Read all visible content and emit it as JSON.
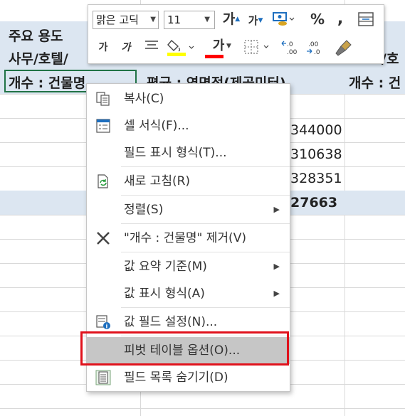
{
  "sheet": {
    "row1_label": "주요 용도",
    "row2_label": "사무/호텔/",
    "row2_right": "/호",
    "header": {
      "col1": "개수 : 건물명",
      "col2": "평균 : 연면적(제곱미터)",
      "col3": "개수 : 건"
    },
    "values": [
      "344000",
      "310638",
      "328351"
    ],
    "total": "27663"
  },
  "mini_toolbar": {
    "font_name": "맑은 고딕",
    "font_size": "11",
    "grow_font": "가",
    "shrink_font": "가",
    "percent": "%",
    "comma": ",",
    "bold": "가",
    "italic": "가",
    "font_color_letter": "가",
    "increase_decimal": "←.0\n.00",
    "decrease_decimal": ".00\n→.0"
  },
  "context_menu": {
    "items": [
      {
        "label": "복사(C)",
        "icon": "copy-icon"
      },
      {
        "label": "셀 서식(F)...",
        "icon": "format-cells-icon"
      },
      {
        "label": "필드 표시 형식(T)...",
        "icon": ""
      },
      {
        "label": "새로 고침(R)",
        "icon": "refresh-icon"
      },
      {
        "label": "정렬(S)",
        "icon": "",
        "submenu": true
      },
      {
        "label": "\"개수 : 건물명\" 제거(V)",
        "icon": "remove-icon"
      },
      {
        "label": "값 요약 기준(M)",
        "icon": "",
        "submenu": true
      },
      {
        "label": "값 표시 형식(A)",
        "icon": "",
        "submenu": true
      },
      {
        "label": "값 필드 설정(N)...",
        "icon": "field-settings-icon"
      },
      {
        "label": "피벗 테이블 옵션(O)...",
        "icon": "",
        "highlighted": true
      },
      {
        "label": "필드 목록 숨기기(D)",
        "icon": "field-list-icon"
      }
    ]
  },
  "colors": {
    "header_band": "#dce6f1",
    "selection": "#217346",
    "highlight": "#c6c6c6",
    "annotation": "#e0121c"
  }
}
